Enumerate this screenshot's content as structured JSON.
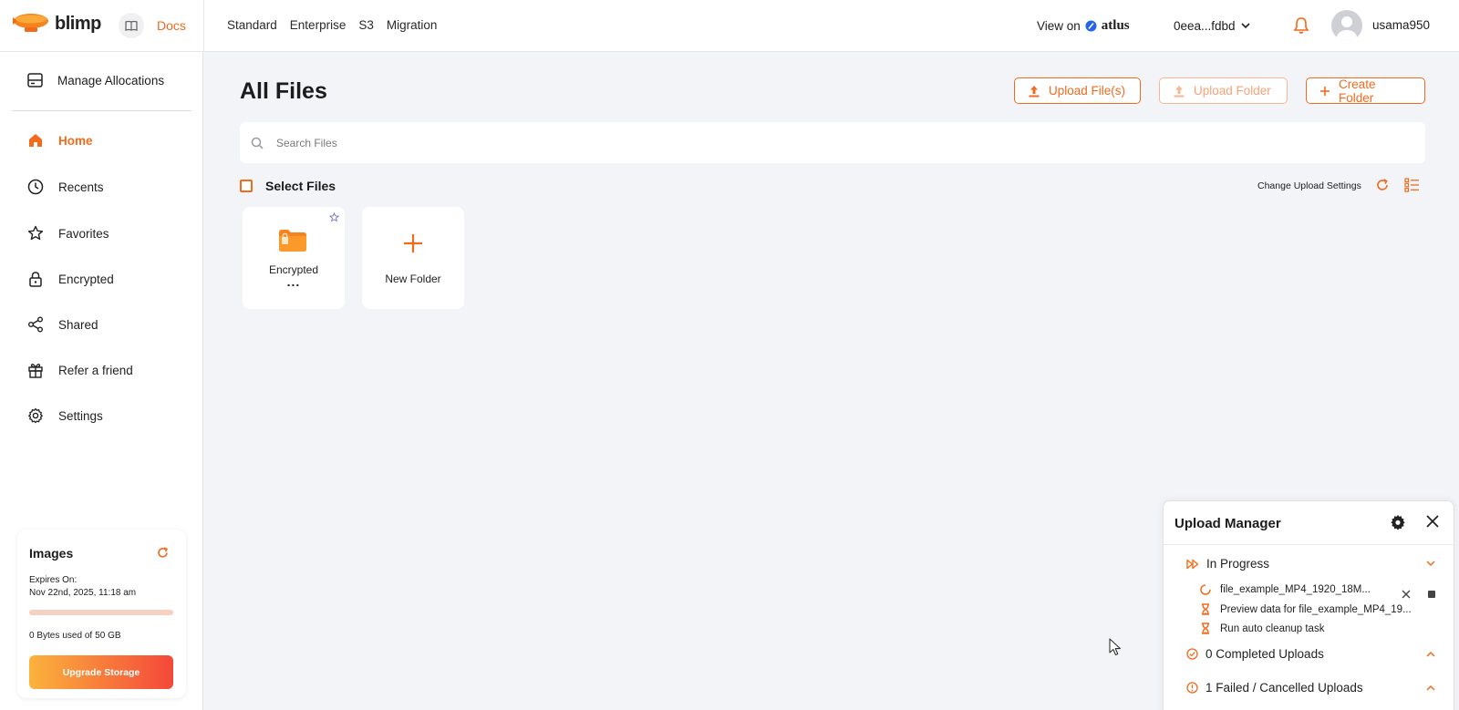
{
  "app": {
    "brand": "blimp",
    "docs_label": "Docs"
  },
  "top_nav": [
    "Standard",
    "Enterprise",
    "S3",
    "Migration"
  ],
  "header": {
    "view_on_label": "View on",
    "atlus_label": "atlus",
    "wallet_address": "0eea...fdbd",
    "username": "usama950"
  },
  "sidebar": {
    "manage_allocations": "Manage Allocations",
    "items": [
      {
        "label": "Home",
        "icon": "home-icon",
        "active": true
      },
      {
        "label": "Recents",
        "icon": "clock-icon",
        "active": false
      },
      {
        "label": "Favorites",
        "icon": "star-icon",
        "active": false
      },
      {
        "label": "Encrypted",
        "icon": "lock-icon",
        "active": false
      },
      {
        "label": "Shared",
        "icon": "share-icon",
        "active": false
      },
      {
        "label": "Refer a friend",
        "icon": "gift-icon",
        "active": false
      },
      {
        "label": "Settings",
        "icon": "gear-icon",
        "active": false
      }
    ]
  },
  "storage": {
    "title": "Images",
    "expires_label": "Expires On:",
    "expires_value": "Nov 22nd, 2025, 11:18 am",
    "used": "0 Bytes",
    "used_of_label": "used of",
    "total": "50 GB",
    "used_fraction": 0,
    "upgrade_label": "Upgrade Storage"
  },
  "main": {
    "title": "All Files",
    "buttons": {
      "upload_files": "Upload File(s)",
      "upload_folder": "Upload Folder",
      "create_folder": "Create Folder"
    },
    "search_placeholder": "Search Files",
    "select_files": "Select Files",
    "change_upload_settings": "Change Upload Settings",
    "tiles": [
      {
        "label": "Encrypted",
        "type": "folder",
        "more": "..."
      },
      {
        "label": "New Folder",
        "type": "new"
      }
    ]
  },
  "upload_manager": {
    "title": "Upload Manager",
    "in_progress_label": "In Progress",
    "rows": [
      {
        "text": "file_example_MP4_1920_18M...",
        "icon": "spinner-icon"
      },
      {
        "text": "Preview data for file_example_MP4_19...",
        "icon": "hourglass-icon"
      },
      {
        "text": "Run auto cleanup task",
        "icon": "hourglass-icon"
      }
    ],
    "completed_label": "0 Completed Uploads",
    "failed_label": "1 Failed / Cancelled Uploads"
  },
  "colors": {
    "accent": "#f26b1d",
    "background": "#f3f4f8"
  }
}
